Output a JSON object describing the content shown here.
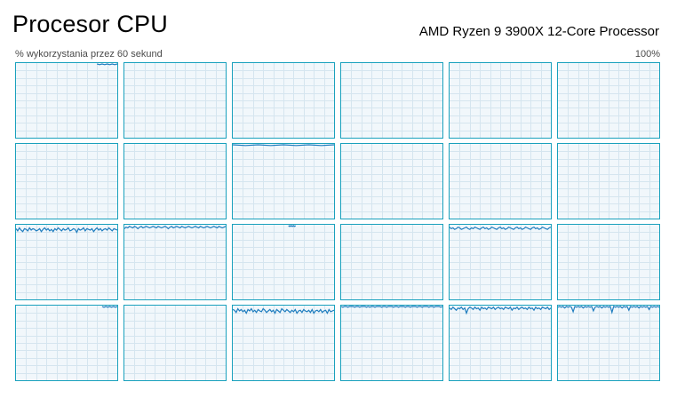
{
  "header": {
    "title": "Procesor CPU",
    "processor_name": "AMD Ryzen 9 3900X 12-Core Processor"
  },
  "graph_area": {
    "caption": "% wykorzystania przez 60 sekund",
    "max_label": "100%"
  },
  "colors": {
    "accent_border": "#1aa1bd",
    "graph_background": "#f1f7fb",
    "grid_line": "#d5e5ef",
    "trace": "#1f7dbf"
  },
  "chart_data": {
    "type": "line",
    "x_range_seconds": [
      0,
      60
    ],
    "ylim": [
      0,
      100
    ],
    "grid": true,
    "logical_processors": [
      {
        "row": 1,
        "col": 1,
        "samples": [],
        "top_segment": [
          80,
          100
        ]
      },
      {
        "row": 1,
        "col": 2,
        "samples": []
      },
      {
        "row": 1,
        "col": 3,
        "samples": []
      },
      {
        "row": 1,
        "col": 4,
        "samples": []
      },
      {
        "row": 1,
        "col": 5,
        "samples": []
      },
      {
        "row": 1,
        "col": 6,
        "samples": []
      },
      {
        "row": 2,
        "col": 1,
        "samples": []
      },
      {
        "row": 2,
        "col": 2,
        "samples": []
      },
      {
        "row": 2,
        "col": 3,
        "samples": [],
        "top_segment": [
          0,
          100
        ]
      },
      {
        "row": 2,
        "col": 4,
        "samples": []
      },
      {
        "row": 2,
        "col": 5,
        "samples": []
      },
      {
        "row": 2,
        "col": 6,
        "samples": []
      },
      {
        "row": 3,
        "col": 1,
        "samples": [
          96,
          93,
          97,
          94,
          92,
          96,
          95,
          93,
          97,
          94,
          96,
          95,
          93,
          94,
          96,
          92,
          95,
          97,
          94,
          96,
          93,
          95,
          92,
          96,
          94,
          97,
          95,
          93,
          96,
          94,
          95,
          97,
          93,
          94,
          96,
          95,
          91,
          96,
          94,
          95,
          97,
          93,
          96,
          95,
          94,
          96,
          92,
          95,
          97,
          94,
          96,
          93,
          95,
          96,
          94,
          97,
          95,
          93,
          96,
          95,
          94
        ]
      },
      {
        "row": 3,
        "col": 2,
        "samples": [
          96,
          98,
          97,
          99,
          98,
          97,
          99,
          98,
          96,
          98,
          99,
          97,
          98,
          99,
          98,
          97,
          98,
          99,
          98,
          97,
          99,
          98,
          97,
          98,
          99,
          98,
          96,
          98,
          99,
          97,
          98,
          99,
          98,
          97,
          99,
          98,
          97,
          98,
          99,
          98,
          97,
          98,
          99,
          98,
          97,
          99,
          98,
          97,
          98,
          99,
          98,
          97,
          98,
          99,
          98,
          97,
          99,
          98,
          97,
          98,
          99
        ]
      },
      {
        "row": 3,
        "col": 3,
        "samples": [],
        "top_segment": [
          55,
          62
        ]
      },
      {
        "row": 3,
        "col": 4,
        "samples": []
      },
      {
        "row": 3,
        "col": 5,
        "samples": [
          98,
          96,
          97,
          95,
          96,
          98,
          97,
          95,
          96,
          97,
          98,
          96,
          95,
          97,
          96,
          98,
          97,
          96,
          95,
          97,
          98,
          96,
          97,
          95,
          96,
          98,
          97,
          96,
          95,
          97,
          98,
          96,
          97,
          95,
          96,
          98,
          97,
          96,
          95,
          97,
          98,
          96,
          97,
          95,
          96,
          98,
          97,
          96,
          95,
          97,
          98,
          96,
          97,
          95,
          96,
          98,
          97,
          96,
          95,
          97,
          98
        ]
      },
      {
        "row": 3,
        "col": 6,
        "samples": []
      },
      {
        "row": 4,
        "col": 1,
        "samples": [],
        "top_segment": [
          85,
          100
        ]
      },
      {
        "row": 4,
        "col": 2,
        "samples": []
      },
      {
        "row": 4,
        "col": 3,
        "samples": [
          96,
          95,
          92,
          97,
          94,
          96,
          93,
          95,
          91,
          96,
          94,
          97,
          93,
          95,
          92,
          96,
          94,
          93,
          97,
          95,
          92,
          94,
          96,
          93,
          95,
          91,
          96,
          94,
          92,
          97,
          95,
          93,
          96,
          94,
          92,
          95,
          93,
          96,
          91,
          94,
          95,
          92,
          96,
          94,
          93,
          95,
          92,
          96,
          91,
          94,
          95,
          93,
          96,
          92,
          94,
          95,
          91,
          96,
          93,
          94,
          95
        ]
      },
      {
        "row": 4,
        "col": 4,
        "samples": [
          100,
          99,
          100,
          100,
          99,
          100,
          100,
          100,
          99,
          100,
          100,
          99,
          100,
          100,
          100,
          99,
          100,
          99,
          100,
          100,
          99,
          100,
          100,
          100,
          99,
          100,
          100,
          99,
          100,
          100,
          100,
          99,
          100,
          100,
          99,
          100,
          100,
          100,
          99,
          100,
          100,
          99,
          100,
          100,
          100,
          99,
          100,
          100,
          99,
          100,
          100,
          100,
          99,
          100,
          100,
          99,
          100,
          100,
          100,
          99,
          100
        ]
      },
      {
        "row": 4,
        "col": 5,
        "samples": [
          98,
          96,
          99,
          97,
          95,
          98,
          97,
          99,
          96,
          98,
          91,
          97,
          99,
          98,
          96,
          99,
          97,
          98,
          95,
          99,
          97,
          98,
          96,
          99,
          98,
          97,
          99,
          96,
          98,
          99,
          97,
          98,
          96,
          99,
          98,
          97,
          99,
          95,
          98,
          97,
          99,
          96,
          98,
          99,
          97,
          98,
          96,
          99,
          97,
          98,
          95,
          99,
          97,
          98,
          96,
          99,
          98,
          97,
          99,
          96,
          98
        ]
      },
      {
        "row": 4,
        "col": 6,
        "samples": [
          99,
          100,
          99,
          100,
          98,
          100,
          99,
          100,
          99,
          93,
          100,
          99,
          100,
          99,
          100,
          98,
          100,
          99,
          100,
          99,
          100,
          94,
          99,
          100,
          99,
          100,
          98,
          100,
          99,
          100,
          99,
          100,
          92,
          100,
          99,
          100,
          99,
          100,
          98,
          100,
          99,
          100,
          95,
          100,
          99,
          100,
          99,
          100,
          98,
          100,
          99,
          100,
          99,
          100,
          96,
          100,
          99,
          100,
          99,
          100,
          99
        ]
      }
    ]
  }
}
